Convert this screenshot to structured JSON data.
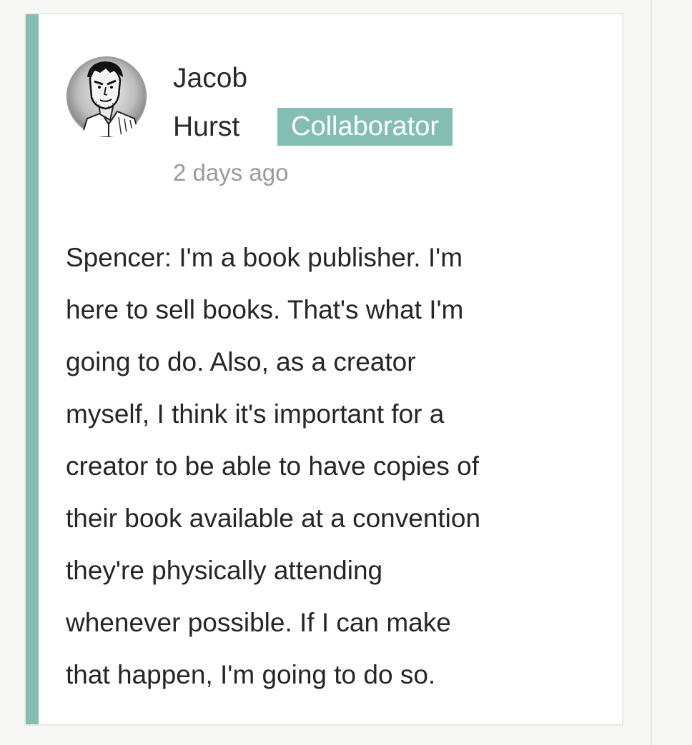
{
  "theme": {
    "accent": "#84bdb4",
    "badge_bg": "#84bdb4"
  },
  "comment": {
    "author": {
      "first_name": "Jacob",
      "last_name": "Hurst",
      "avatar_icon": "user-avatar-icon"
    },
    "role_badge": "Collaborator",
    "timestamp": "2 days ago",
    "body_lines": [
      "Spencer: I'm a book publisher. I'm",
      "here to sell books. That's what I'm",
      "going to do. Also, as a creator",
      "myself, I think it's important for a",
      "creator to be able to have copies of",
      "their book available at a convention",
      "they're physically attending",
      "whenever possible. If I can make",
      "that happen, I'm going to do so."
    ]
  }
}
